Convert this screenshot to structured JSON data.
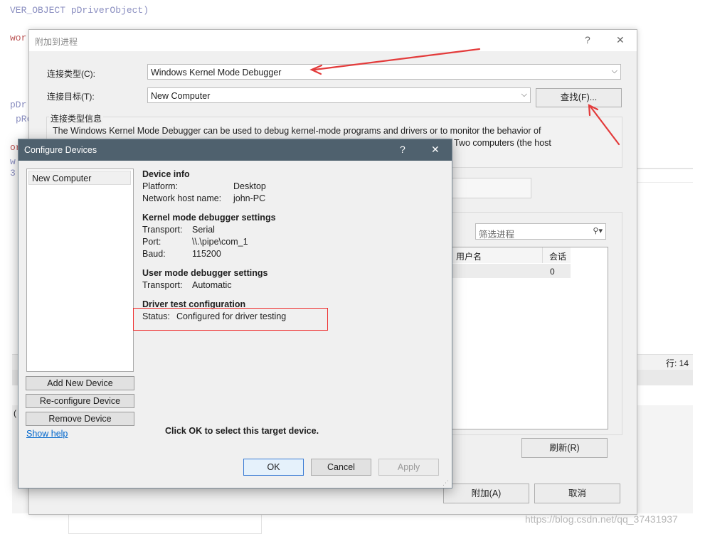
{
  "background": {
    "code_line_1": "VER_OBJECT pDriverObject)",
    "code_frag_1": "wor",
    "code_frag_2": "pDr",
    "code_frag_3": "pRe",
    "code_frag_4": "or",
    "code_frag_5": "w",
    "code_frag_6": "3",
    "status_line": "行: 14",
    "watermark": "https://blog.csdn.net/qq_37431937",
    "paren": "("
  },
  "attach_dialog": {
    "title": "附加到进程",
    "help_glyph": "?",
    "close_glyph": "✕",
    "connection_type_label": "连接类型(C):",
    "connection_type_value": "Windows Kernel Mode Debugger",
    "connection_target_label": "连接目标(T):",
    "connection_target_value": "New Computer",
    "find_button": "查找(F)...",
    "info_group_label": "连接类型信息",
    "info_text_line1": "The Windows Kernel Mode Debugger can be used to debug kernel-mode programs and drivers or to monitor the behavior of",
    "info_text_line2": "Two computers (the host",
    "filter_placeholder": "筛选进程",
    "col_user": "用户名",
    "col_session": "会话",
    "row_session": "0",
    "refresh_button": "刷新(R)",
    "attach_button": "附加(A)",
    "cancel_button": "取消"
  },
  "configure_dialog": {
    "title": "Configure Devices",
    "help_glyph": "?",
    "close_glyph": "✕",
    "devices": [
      "New Computer"
    ],
    "device_info_heading": "Device info",
    "platform_label": "Platform:",
    "platform_value": "Desktop",
    "host_label": "Network host name:",
    "host_value": "john-PC",
    "kernel_heading": "Kernel mode debugger settings",
    "k_transport_label": "Transport:",
    "k_transport_value": "Serial",
    "k_port_label": "Port:",
    "k_port_value": "\\\\.\\pipe\\com_1",
    "k_baud_label": "Baud:",
    "k_baud_value": "115200",
    "user_heading": "User mode debugger settings",
    "u_transport_label": "Transport:",
    "u_transport_value": "Automatic",
    "driver_heading": "Driver test configuration",
    "status_label": "Status:",
    "status_value": "Configured for driver testing",
    "add_device": "Add New Device",
    "reconfigure_device": "Re-configure Device",
    "remove_device": "Remove Device",
    "show_help": "Show help",
    "hint": "Click OK to select this target device.",
    "ok": "OK",
    "cancel": "Cancel",
    "apply": "Apply"
  },
  "colors": {
    "annotation_red": "#e33b3b",
    "titlebar": "#4f616e",
    "ok_border": "#3a7bd5"
  }
}
